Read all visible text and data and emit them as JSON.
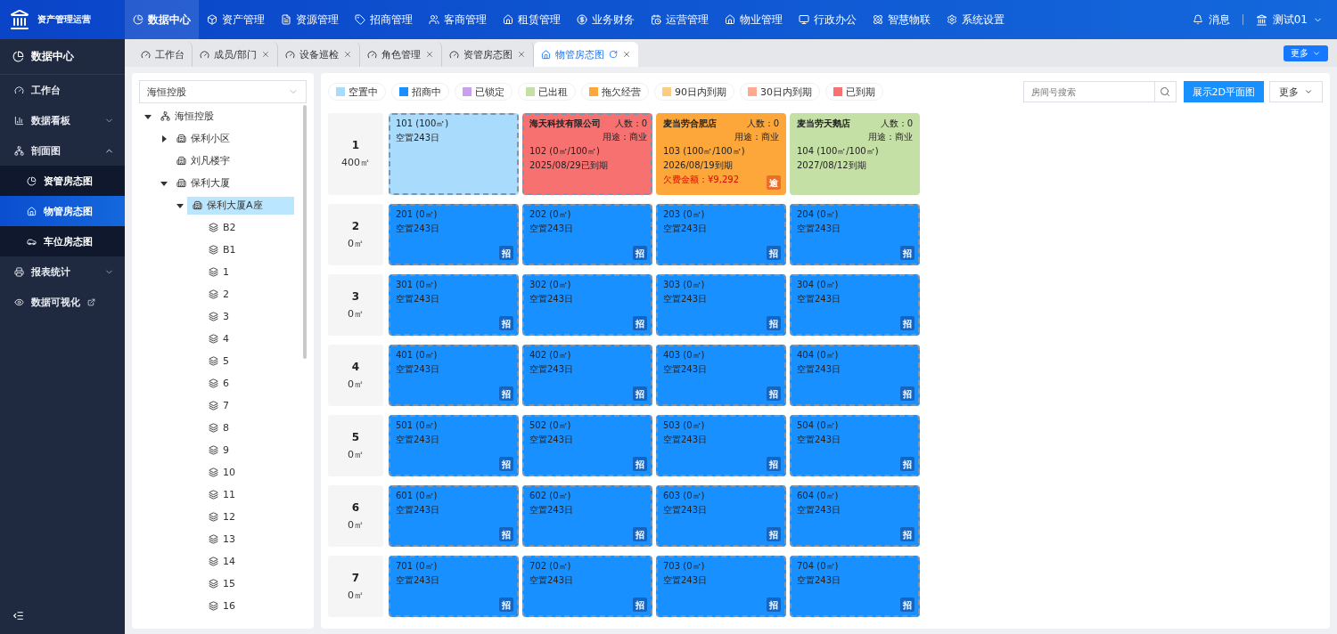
{
  "app": {
    "title": "资产管理运营"
  },
  "nav": [
    {
      "label": "数据中心",
      "selected": true
    },
    {
      "label": "资产管理",
      "selected": false
    },
    {
      "label": "资源管理",
      "selected": false
    },
    {
      "label": "招商管理",
      "selected": false
    },
    {
      "label": "客商管理",
      "selected": false
    },
    {
      "label": "租赁管理",
      "selected": false
    },
    {
      "label": "业务财务",
      "selected": false
    },
    {
      "label": "运营管理",
      "selected": false
    },
    {
      "label": "物业管理",
      "selected": false
    },
    {
      "label": "行政办公",
      "selected": false
    },
    {
      "label": "智慧物联",
      "selected": false
    },
    {
      "label": "系统设置",
      "selected": false
    }
  ],
  "header": {
    "messages": "消息",
    "user": "测试01"
  },
  "sidebar": {
    "title": "数据中心",
    "items": [
      {
        "label": "工作台"
      },
      {
        "label": "数据看板",
        "expanded": false
      },
      {
        "label": "剖面图",
        "expanded": true,
        "children": [
          {
            "label": "资管房态图",
            "selected": false
          },
          {
            "label": "物管房态图",
            "selected": true
          },
          {
            "label": "车位房态图",
            "selected": false
          }
        ]
      },
      {
        "label": "报表统计",
        "expanded": false
      },
      {
        "label": "数据可视化",
        "external": true
      }
    ]
  },
  "tabs": [
    {
      "label": "工作台",
      "selected": false,
      "closable": false
    },
    {
      "label": "成员/部门",
      "selected": false,
      "closable": true
    },
    {
      "label": "设备巡检",
      "selected": false,
      "closable": true
    },
    {
      "label": "角色管理",
      "selected": false,
      "closable": true
    },
    {
      "label": "资管房态图",
      "selected": false,
      "closable": true
    },
    {
      "label": "物管房态图",
      "selected": true,
      "closable": true
    }
  ],
  "tabs_more": "更多",
  "tree": {
    "select": "海恒控股",
    "nodes": [
      {
        "label": "海恒控股",
        "kind": "org",
        "expanded": true,
        "selected": false,
        "children": [
          {
            "label": "保利小区",
            "kind": "building",
            "expanded": false,
            "selected": false
          },
          {
            "label": "刘凡楼宇",
            "kind": "building",
            "selected": false
          },
          {
            "label": "保利大厦",
            "kind": "building",
            "expanded": true,
            "selected": false,
            "children": [
              {
                "label": "保利大厦A座",
                "kind": "building",
                "expanded": true,
                "selected": true,
                "children": [
                  {
                    "label": "B2",
                    "kind": "floor",
                    "selected": false
                  },
                  {
                    "label": "B1",
                    "kind": "floor",
                    "selected": false
                  },
                  {
                    "label": "1",
                    "kind": "floor",
                    "selected": false
                  },
                  {
                    "label": "2",
                    "kind": "floor",
                    "selected": false
                  },
                  {
                    "label": "3",
                    "kind": "floor",
                    "selected": false
                  },
                  {
                    "label": "4",
                    "kind": "floor",
                    "selected": false
                  },
                  {
                    "label": "5",
                    "kind": "floor",
                    "selected": false
                  },
                  {
                    "label": "6",
                    "kind": "floor",
                    "selected": false
                  },
                  {
                    "label": "7",
                    "kind": "floor",
                    "selected": false
                  },
                  {
                    "label": "8",
                    "kind": "floor",
                    "selected": false
                  },
                  {
                    "label": "9",
                    "kind": "floor",
                    "selected": false
                  },
                  {
                    "label": "10",
                    "kind": "floor",
                    "selected": false
                  },
                  {
                    "label": "11",
                    "kind": "floor",
                    "selected": false
                  },
                  {
                    "label": "12",
                    "kind": "floor",
                    "selected": false
                  },
                  {
                    "label": "13",
                    "kind": "floor",
                    "selected": false
                  },
                  {
                    "label": "14",
                    "kind": "floor",
                    "selected": false
                  },
                  {
                    "label": "15",
                    "kind": "floor",
                    "selected": false
                  },
                  {
                    "label": "16",
                    "kind": "floor",
                    "selected": false
                  }
                ]
              }
            ]
          }
        ]
      }
    ]
  },
  "legend": [
    {
      "label": "空置中",
      "color": "#a9dcfc"
    },
    {
      "label": "招商中",
      "color": "#1890ff"
    },
    {
      "label": "已锁定",
      "color": "#c9a0f0"
    },
    {
      "label": "已出租",
      "color": "#c5e0a5"
    },
    {
      "label": "拖欠经营",
      "color": "#fda63a"
    },
    {
      "label": "90日内到期",
      "color": "#fdcb82"
    },
    {
      "label": "30日内到期",
      "color": "#fdaa90"
    },
    {
      "label": "已到期",
      "color": "#f87171"
    }
  ],
  "search": {
    "placeholder": "房间号搜索"
  },
  "buttons": {
    "show2d": "展示2D平面图",
    "more": "更多"
  },
  "floors": [
    {
      "name": "1",
      "area": "400㎡",
      "rooms": [
        {
          "code": "101 (100㎡)",
          "note": "空置243日",
          "color": "#a9dcfc",
          "vacant": true
        },
        {
          "tenant": "海天科技有限公司",
          "people": "人数：0",
          "usage": "用途：商业",
          "code": "102 (0㎡/100㎡)",
          "note": "2025/08/29已到期",
          "color": "#f87171",
          "vacant": true
        },
        {
          "tenant": "麦当劳合肥店",
          "people": "人数：0",
          "usage": "用途：商业",
          "code": "103 (100㎡/100㎡)",
          "note": "2026/08/19到期",
          "arrears": "欠费金额：¥9,292",
          "badge": "逾",
          "color": "#fda63a",
          "vacant": false
        },
        {
          "tenant": "麦当劳天鹅店",
          "people": "人数：0",
          "usage": "用途：商业",
          "code": "104 (100㎡/100㎡)",
          "note": "2027/08/12到期",
          "color": "#c5e0a5",
          "vacant": false
        }
      ]
    },
    {
      "name": "2",
      "area": "0㎡",
      "rooms": [
        {
          "code": "201 (0㎡)",
          "note": "空置243日",
          "badge": "招",
          "color": "#1890ff",
          "vacant": true
        },
        {
          "code": "202 (0㎡)",
          "note": "空置243日",
          "badge": "招",
          "color": "#1890ff",
          "vacant": true
        },
        {
          "code": "203 (0㎡)",
          "note": "空置243日",
          "badge": "招",
          "color": "#1890ff",
          "vacant": true
        },
        {
          "code": "204 (0㎡)",
          "note": "空置243日",
          "badge": "招",
          "color": "#1890ff",
          "vacant": true
        }
      ]
    },
    {
      "name": "3",
      "area": "0㎡",
      "rooms": [
        {
          "code": "301 (0㎡)",
          "note": "空置243日",
          "badge": "招",
          "color": "#1890ff",
          "vacant": true
        },
        {
          "code": "302 (0㎡)",
          "note": "空置243日",
          "badge": "招",
          "color": "#1890ff",
          "vacant": true
        },
        {
          "code": "303 (0㎡)",
          "note": "空置243日",
          "badge": "招",
          "color": "#1890ff",
          "vacant": true
        },
        {
          "code": "304 (0㎡)",
          "note": "空置243日",
          "badge": "招",
          "color": "#1890ff",
          "vacant": true
        }
      ]
    },
    {
      "name": "4",
      "area": "0㎡",
      "rooms": [
        {
          "code": "401 (0㎡)",
          "note": "空置243日",
          "badge": "招",
          "color": "#1890ff",
          "vacant": true
        },
        {
          "code": "402 (0㎡)",
          "note": "空置243日",
          "badge": "招",
          "color": "#1890ff",
          "vacant": true
        },
        {
          "code": "403 (0㎡)",
          "note": "空置243日",
          "badge": "招",
          "color": "#1890ff",
          "vacant": true
        },
        {
          "code": "404 (0㎡)",
          "note": "空置243日",
          "badge": "招",
          "color": "#1890ff",
          "vacant": true
        }
      ]
    },
    {
      "name": "5",
      "area": "0㎡",
      "rooms": [
        {
          "code": "501 (0㎡)",
          "note": "空置243日",
          "badge": "招",
          "color": "#1890ff",
          "vacant": true
        },
        {
          "code": "502 (0㎡)",
          "note": "空置243日",
          "badge": "招",
          "color": "#1890ff",
          "vacant": true
        },
        {
          "code": "503 (0㎡)",
          "note": "空置243日",
          "badge": "招",
          "color": "#1890ff",
          "vacant": true
        },
        {
          "code": "504 (0㎡)",
          "note": "空置243日",
          "badge": "招",
          "color": "#1890ff",
          "vacant": true
        }
      ]
    },
    {
      "name": "6",
      "area": "0㎡",
      "rooms": [
        {
          "code": "601 (0㎡)",
          "note": "空置243日",
          "badge": "招",
          "color": "#1890ff",
          "vacant": true
        },
        {
          "code": "602 (0㎡)",
          "note": "空置243日",
          "badge": "招",
          "color": "#1890ff",
          "vacant": true
        },
        {
          "code": "603 (0㎡)",
          "note": "空置243日",
          "badge": "招",
          "color": "#1890ff",
          "vacant": true
        },
        {
          "code": "604 (0㎡)",
          "note": "空置243日",
          "badge": "招",
          "color": "#1890ff",
          "vacant": true
        }
      ]
    },
    {
      "name": "7",
      "area": "0㎡",
      "rooms": [
        {
          "code": "701 (0㎡)",
          "note": "空置243日",
          "badge": "招",
          "color": "#1890ff",
          "vacant": true
        },
        {
          "code": "702 (0㎡)",
          "note": "空置243日",
          "badge": "招",
          "color": "#1890ff",
          "vacant": true
        },
        {
          "code": "703 (0㎡)",
          "note": "空置243日",
          "badge": "招",
          "color": "#1890ff",
          "vacant": true
        },
        {
          "code": "704 (0㎡)",
          "note": "空置243日",
          "badge": "招",
          "color": "#1890ff",
          "vacant": true
        }
      ]
    }
  ]
}
